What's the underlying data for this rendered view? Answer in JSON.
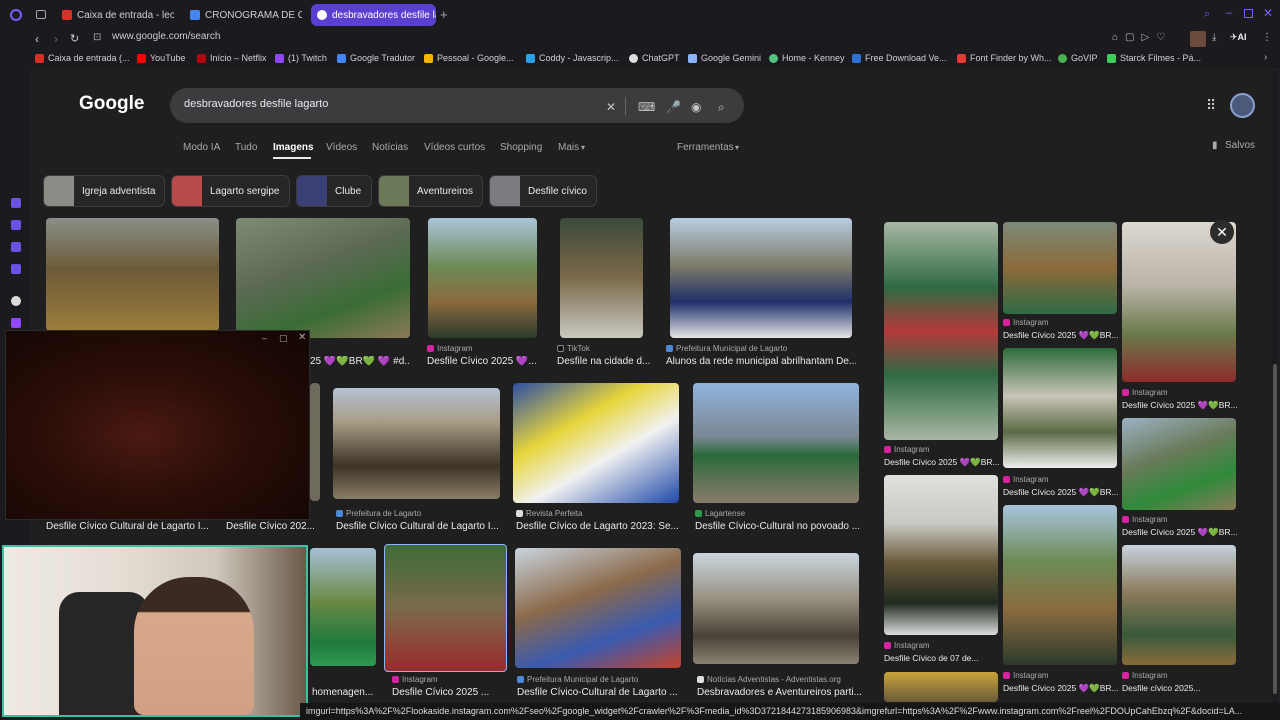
{
  "colors": {
    "accent": "#5b3fd1",
    "page_bg": "#1f1f1f",
    "chrome_bg": "#1b1b1f",
    "cam_border": "#39c2a2"
  },
  "tabs": [
    {
      "label": "Caixa de entrada - leoand",
      "icon": "gmail-icon"
    },
    {
      "label": "CRONOGRAMA DE CADA",
      "icon": "docs-icon"
    },
    {
      "label": "desbravadores desfile lag",
      "icon": "google-icon"
    }
  ],
  "address": {
    "url": "www.google.com/search"
  },
  "bookmarks": [
    "Caixa de entrada (...",
    "YouTube",
    "Início – Netflix",
    "(1) Twitch",
    "Google Tradutor",
    "Pessoal - Google...",
    "Coddy - Javascrip...",
    "ChatGPT",
    "Google Gemini",
    "Home - Kenney",
    "Free Download Ve...",
    "Font Finder by Wh...",
    "GoVIP",
    "Starck Filmes - Pá..."
  ],
  "google": {
    "logo": "Google",
    "query": "desbravadores desfile lagarto",
    "nav": [
      "Modo IA",
      "Tudo",
      "Imagens",
      "Vídeos",
      "Notícias",
      "Vídeos curtos",
      "Shopping",
      "Mais"
    ],
    "tools": "Ferramentas",
    "saved": "Salvos",
    "chips": [
      "Igreja adventista",
      "Lagarto sergipe",
      "Clube",
      "Aventureiros",
      "Desfile cívico"
    ]
  },
  "results": [
    {
      "source": "",
      "caption": ""
    },
    {
      "source": "",
      "caption": "25 💜💚BR💚 💜 #d..."
    },
    {
      "source": "Instagram",
      "caption": "Desfile Cívico 2025 💜..."
    },
    {
      "source": "TikTok",
      "caption": "Desfile na cidade d..."
    },
    {
      "source": "Prefeitura Municipal de Lagarto",
      "caption": "Alunos da rede municipal abrilhantam De..."
    },
    {
      "source": "",
      "caption": "Desfile Cívico Cultural de Lagarto I..."
    },
    {
      "source": "",
      "caption": "Desfile Cívico 202..."
    },
    {
      "source": "Prefeitura de Lagarto",
      "caption": "Desfile Cívico Cultural de Lagarto I..."
    },
    {
      "source": "Revista Perfeita",
      "caption": "Desfile Cívico de Lagarto 2023: Se..."
    },
    {
      "source": "Lagartense",
      "caption": "Desfile Cívico-Cultural no povoado ..."
    },
    {
      "source": "",
      "caption": "homenagen..."
    },
    {
      "source": "Instagram",
      "caption": "Desfile Cívico 2025 ..."
    },
    {
      "source": "Prefeitura Municipal de Lagarto",
      "caption": "Desfile Cívico-Cultural de Lagarto ..."
    },
    {
      "source": "Notícias Adventistas - Adventistas.org",
      "caption": "Desbravadores e Aventureiros parti..."
    }
  ],
  "panel": [
    {
      "source": "Instagram",
      "caption": "Desfile Cívico 2025 💜💚BR..."
    },
    {
      "source": "Instagram",
      "caption": "Desfile Cívico 2025 💜💚BR..."
    },
    {
      "source": "Instagram",
      "caption": "Desfile Cívico 2025 💜💚BR..."
    },
    {
      "source": "Instagram",
      "caption": "Desfile Cívico 2025 💜💚BR..."
    },
    {
      "source": "Instagram",
      "caption": "Desfile Cívico 2025 💜💚BR..."
    },
    {
      "source": "Instagram",
      "caption": "Desfile Cívico de 07 de..."
    },
    {
      "source": "Instagram",
      "caption": "Desfile Cívico 2025 💜💚BR..."
    },
    {
      "source": "Instagram",
      "caption": "Desfile cívico 2025..."
    }
  ],
  "statusbar": "imgurl=https%3A%2F%2Flookaside.instagram.com%2Fseo%2Fgoogle_widget%2Fcrawler%2F%3Fmedia_id%3D3721844273185906983&imgrefurl=https%3A%2F%2Fwww.instagram.com%2Freel%2FDOUpCahEbzq%2F&docid=LA..."
}
